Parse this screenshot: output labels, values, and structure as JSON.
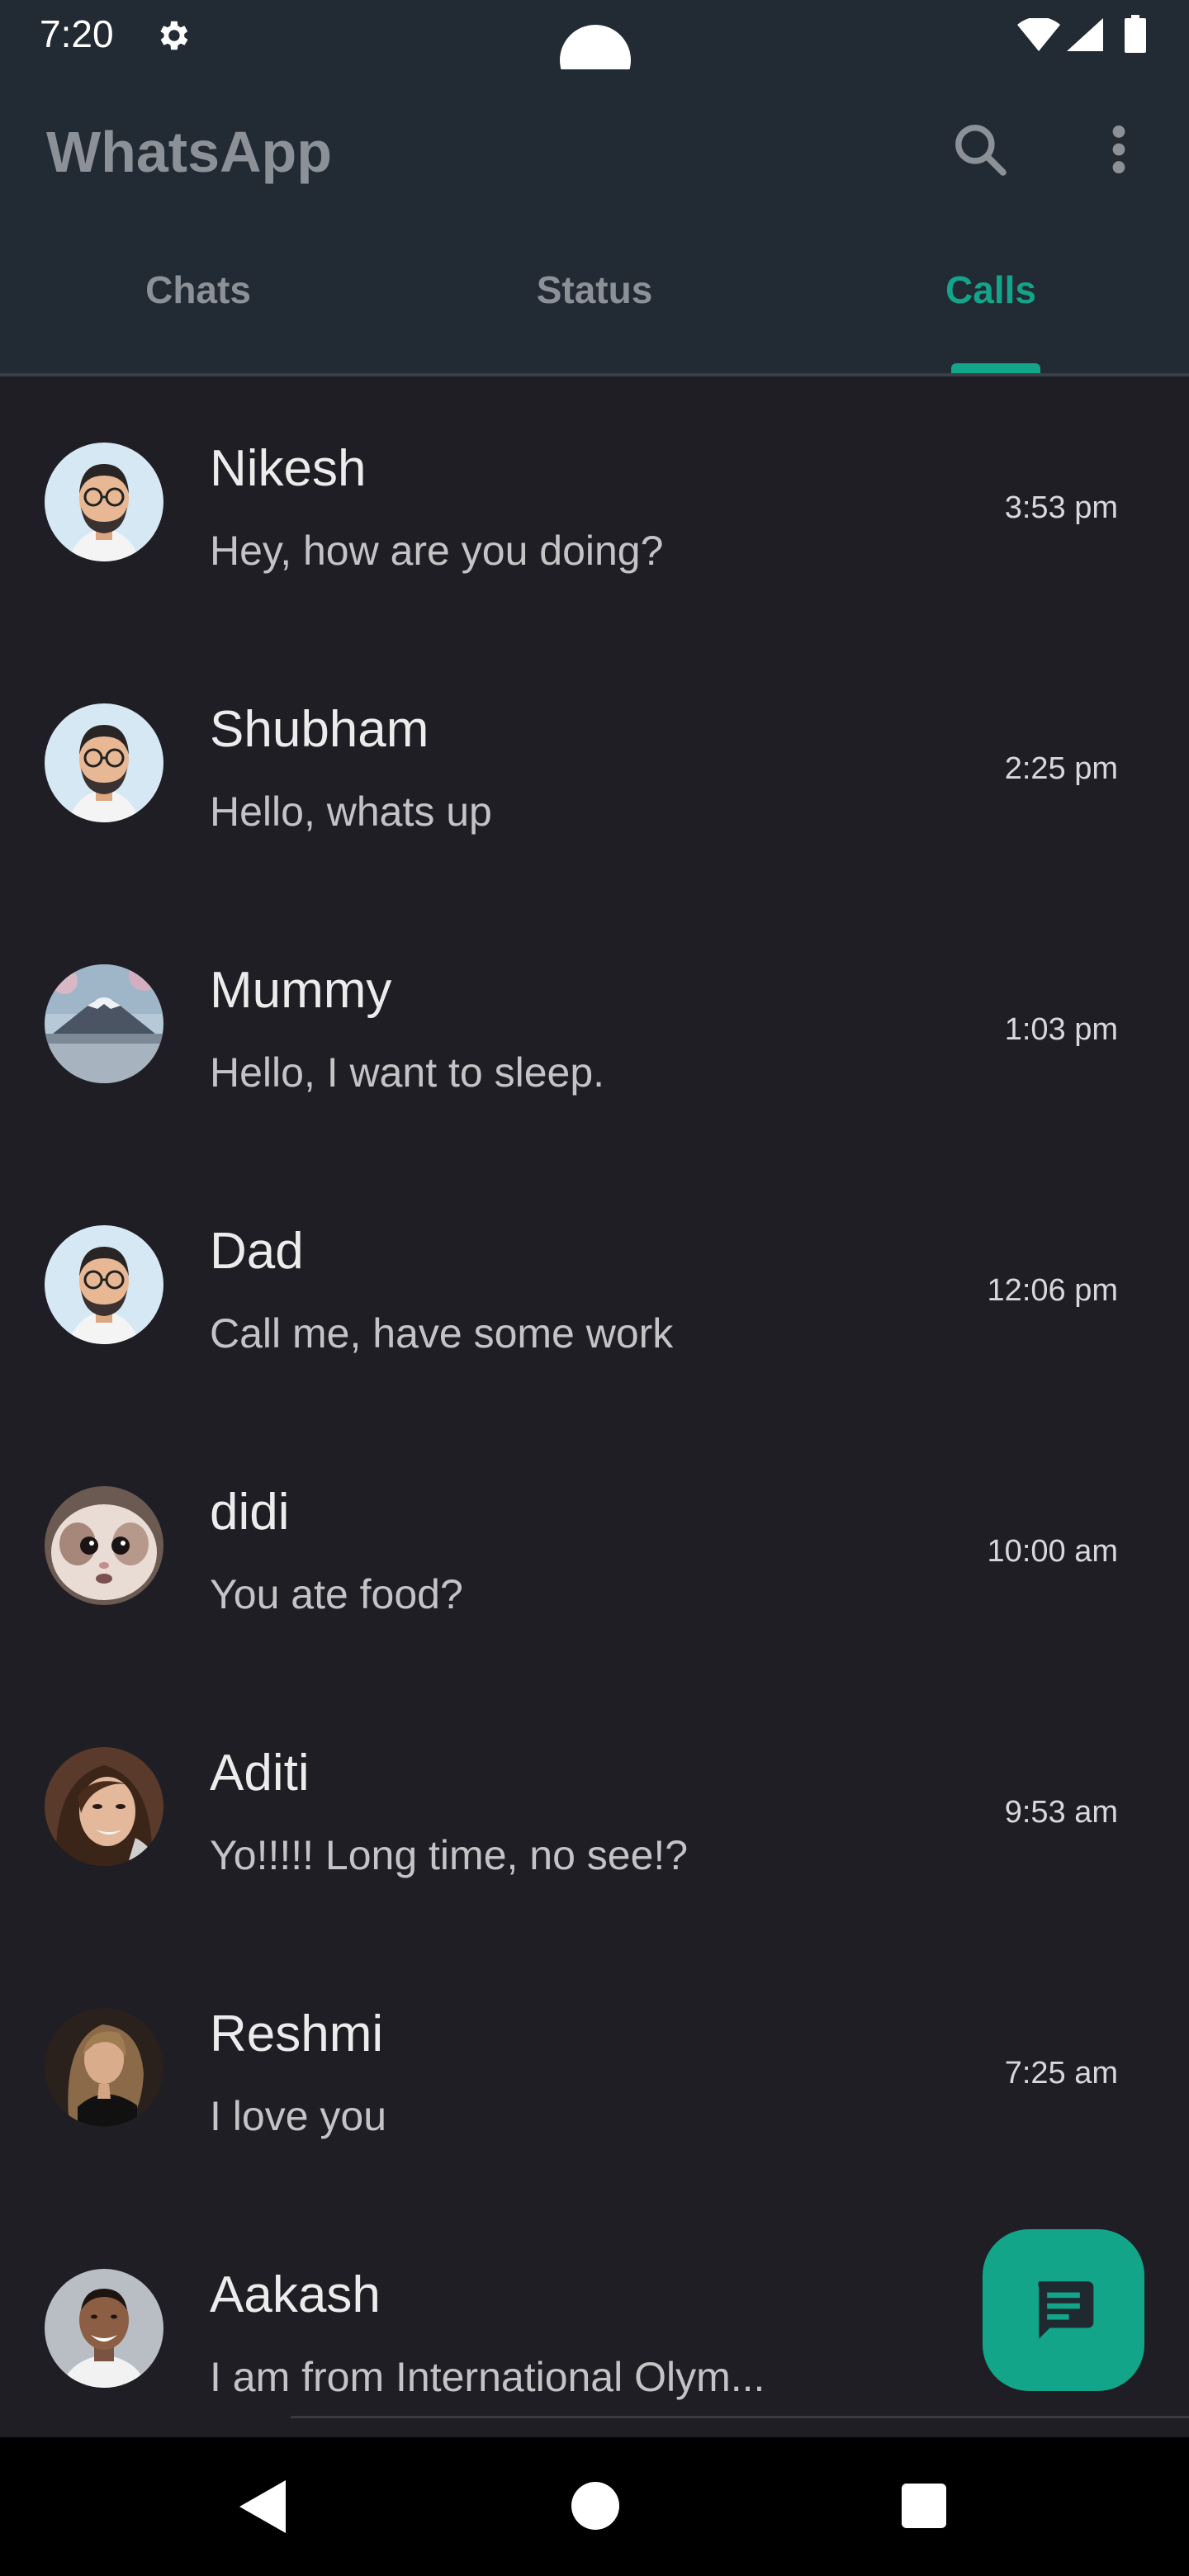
{
  "status_bar": {
    "time": "7:20",
    "icons": [
      "gear-icon",
      "wifi-icon",
      "signal-icon",
      "battery-icon"
    ]
  },
  "app_bar": {
    "title": "WhatsApp",
    "actions": [
      "search-icon",
      "more-vert-icon"
    ],
    "tabs": [
      {
        "label": "Chats",
        "active": false
      },
      {
        "label": "Status",
        "active": false
      },
      {
        "label": "Calls",
        "active": true
      }
    ]
  },
  "chats": [
    {
      "name": "Nikesh",
      "message": "Hey, how are you doing?",
      "time": "3:53 pm",
      "avatar": "memoji-avatar"
    },
    {
      "name": "Shubham",
      "message": "Hello, whats up",
      "time": "2:25 pm",
      "avatar": "memoji-avatar"
    },
    {
      "name": "Mummy",
      "message": "Hello, I want to sleep.",
      "time": "1:03 pm",
      "avatar": "mountain-photo-avatar"
    },
    {
      "name": "Dad",
      "message": "Call me, have some work",
      "time": "12:06 pm",
      "avatar": "memoji-avatar"
    },
    {
      "name": "didi",
      "message": "You ate food?",
      "time": "10:00 am",
      "avatar": "cat-photo-avatar"
    },
    {
      "name": "Aditi",
      "message": "Yo!!!!! Long time, no see!?",
      "time": "9:53 am",
      "avatar": "woman-photo-avatar"
    },
    {
      "name": "Reshmi",
      "message": "I love you",
      "time": "7:25 am",
      "avatar": "woman-photo-avatar"
    },
    {
      "name": "Aakash",
      "message": "I am from International Olym...",
      "time": "",
      "avatar": "man-photo-avatar"
    }
  ],
  "fab": {
    "icon": "message-icon"
  },
  "nav_bar": {
    "buttons": [
      "back-icon",
      "home-icon",
      "recents-icon"
    ]
  },
  "colors": {
    "accent": "#12a58a",
    "app_bar_bg": "#222a33",
    "list_bg": "#1f1e24",
    "muted_text": "#8b9197"
  }
}
